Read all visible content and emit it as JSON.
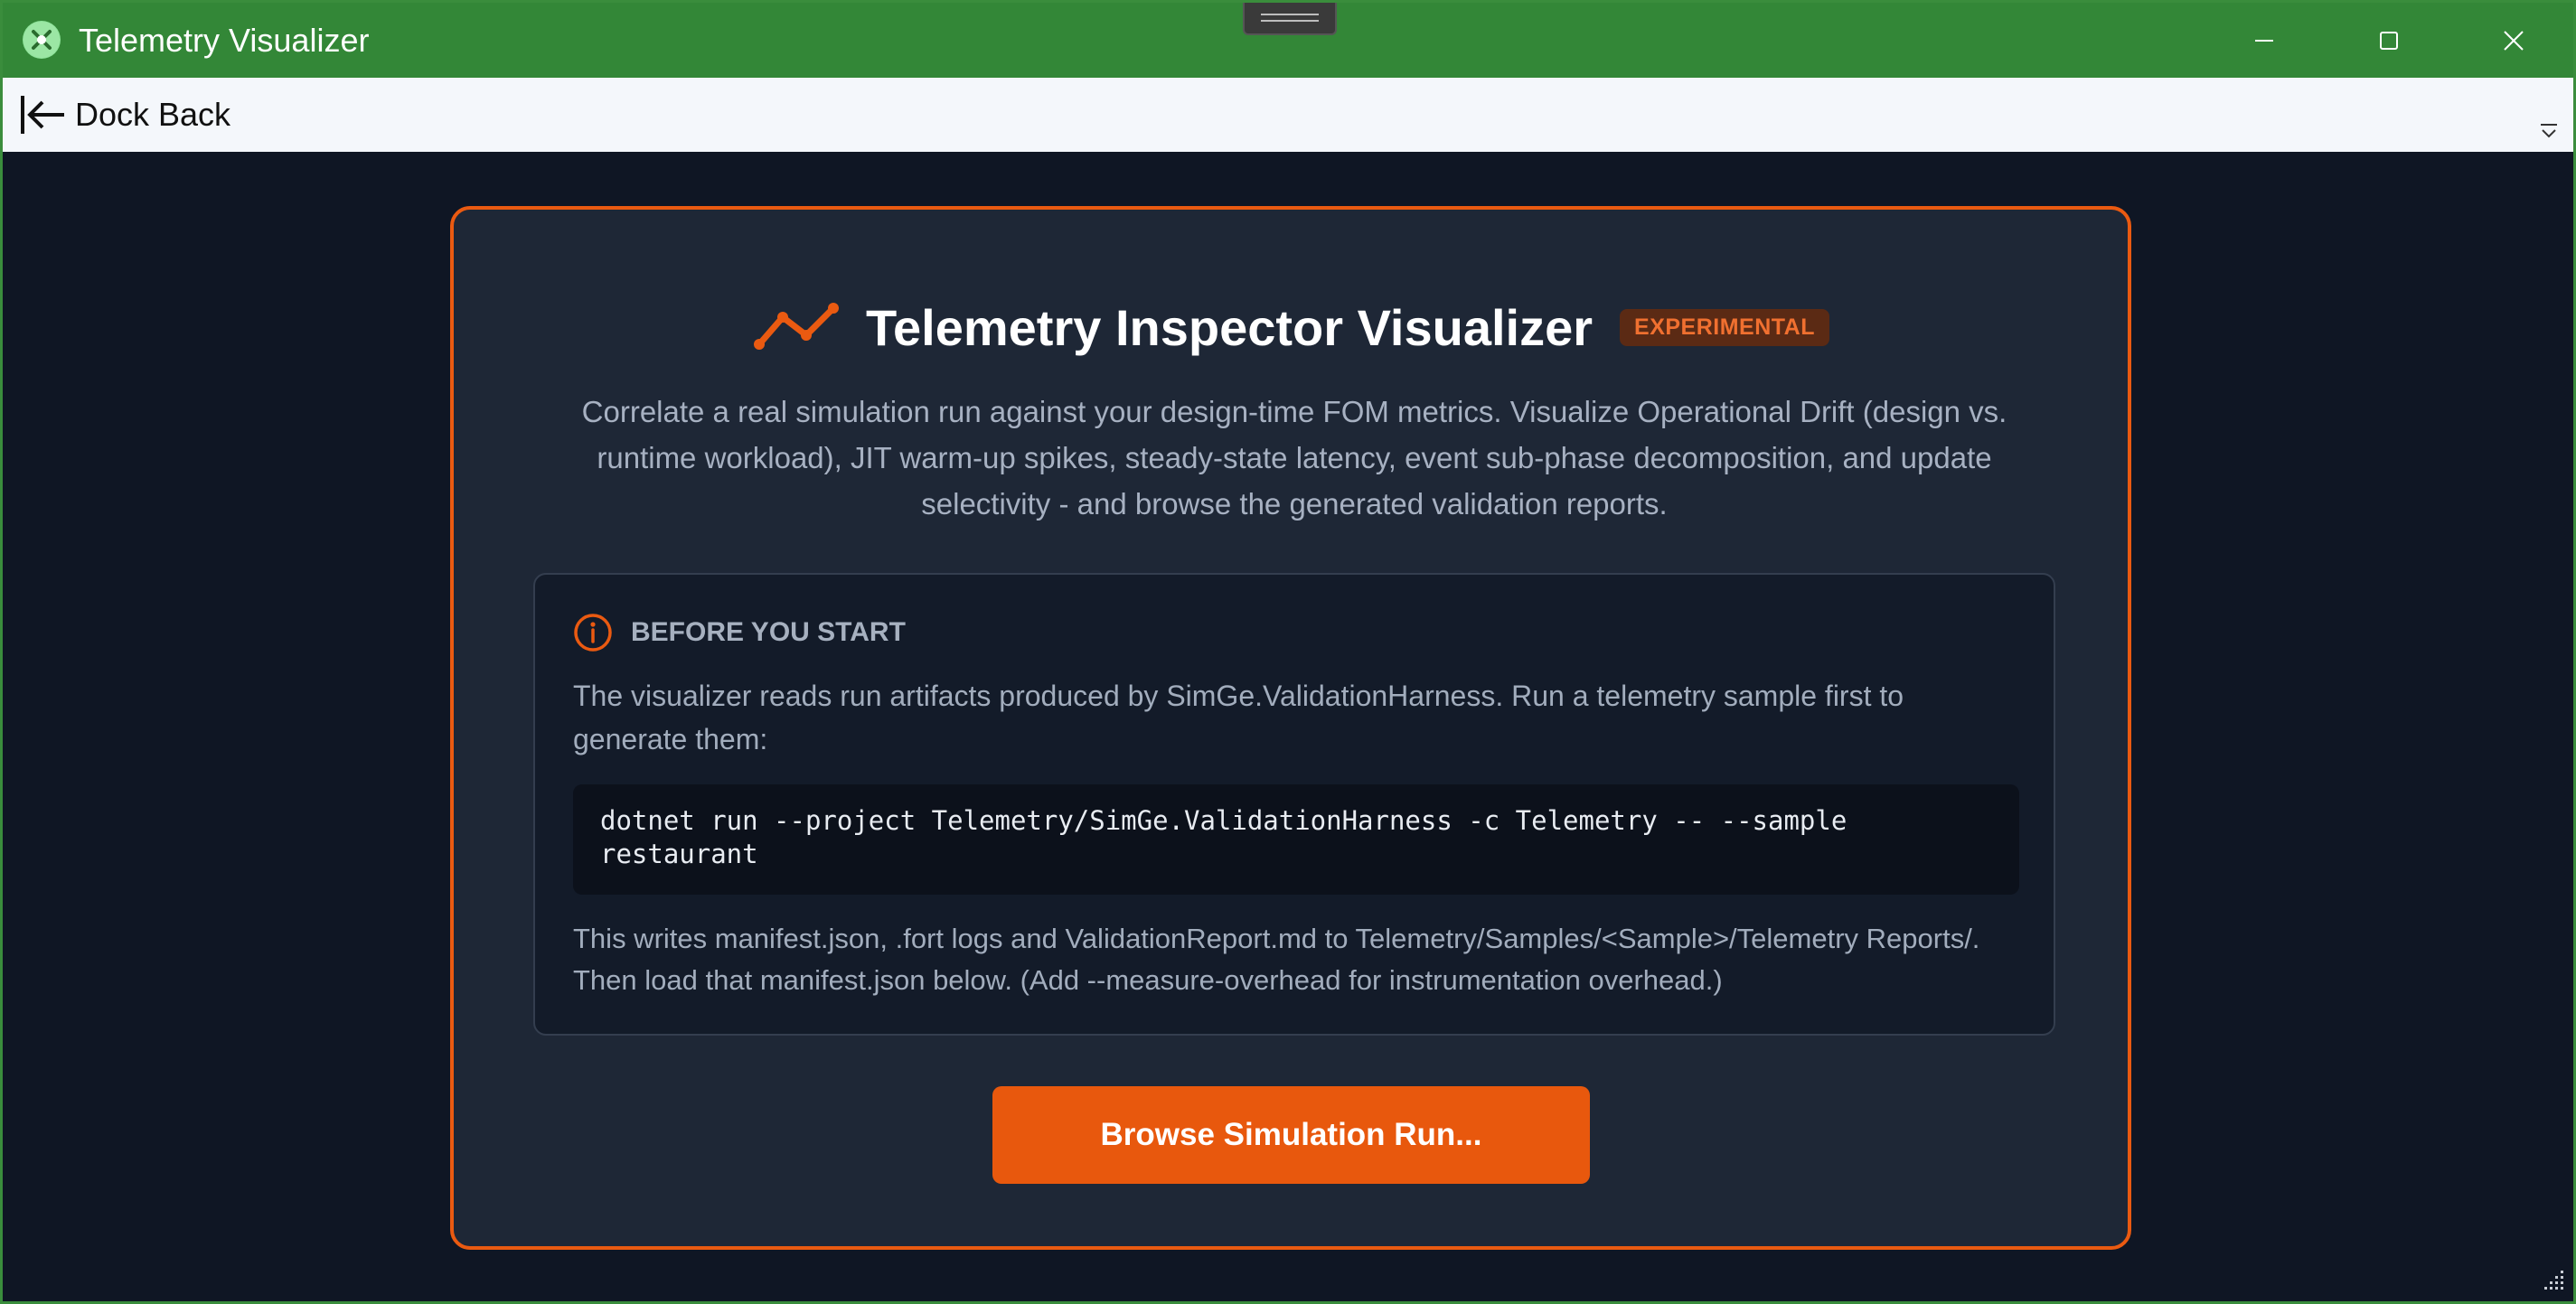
{
  "window": {
    "title": "Telemetry Visualizer",
    "icon": "app-logo-icon",
    "controls": [
      "minimize-icon",
      "maximize-icon",
      "close-icon"
    ],
    "titlebar_color": "#338737"
  },
  "toolbar": {
    "dock_back_label": "Dock Back",
    "dock_back_icon": "dock-back-arrow-icon",
    "overflow_icon": "overflow-chevron-icon"
  },
  "card": {
    "title": "Telemetry Inspector Visualizer",
    "badge": "EXPERIMENTAL",
    "icon": "trend-line-icon",
    "accent_color": "#ea5a11",
    "description": "Correlate a real simulation run against your design-time FOM metrics. Visualize Operational Drift (design vs. runtime workload), JIT warm-up spikes, steady-state latency, event sub-phase decomposition, and update selectivity - and browse the generated validation reports."
  },
  "info": {
    "icon": "info-icon",
    "title": "BEFORE YOU START",
    "body": "The visualizer reads run artifacts produced by SimGe.ValidationHarness. Run a telemetry sample first to generate them:",
    "code": "dotnet run --project Telemetry/SimGe.ValidationHarness -c Telemetry -- --sample restaurant",
    "footer": "This writes manifest.json, .fort logs and ValidationReport.md to Telemetry/Samples/<Sample>/Telemetry Reports/. Then load that manifest.json below. (Add --measure-overhead for instrumentation overhead.)"
  },
  "actions": {
    "browse_label": "Browse Simulation Run..."
  }
}
